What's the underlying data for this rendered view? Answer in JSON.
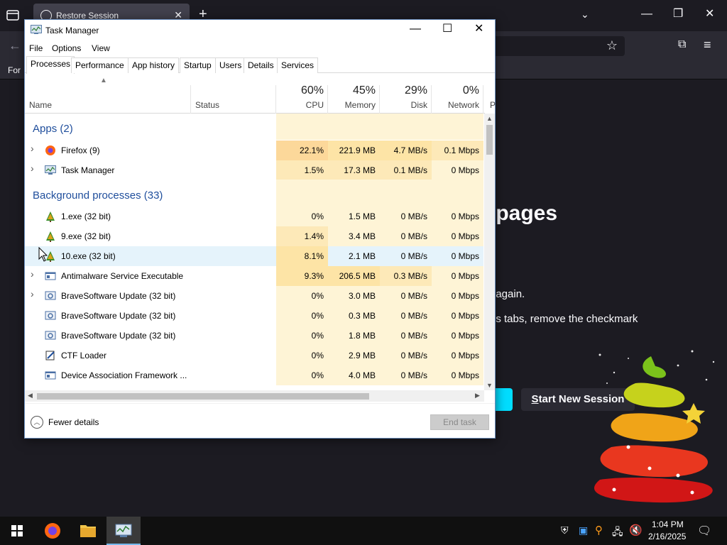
{
  "firefox": {
    "tab_title": "Restore Session",
    "bookmarks_label": "For",
    "heading": "ur pages",
    "para1": "/ again.",
    "para2": "us tabs, remove the checkmark",
    "start_new_session": "Start New Session",
    "accent": "#00ddff"
  },
  "taskmanager": {
    "title": "Task Manager",
    "menu": [
      "File",
      "Options",
      "View"
    ],
    "tabs": [
      "Processes",
      "Performance",
      "App history",
      "Startup",
      "Users",
      "Details",
      "Services"
    ],
    "active_tab": "Processes",
    "columns": {
      "name": "Name",
      "status": "Status",
      "cpu": {
        "pct": "60%",
        "label": "CPU"
      },
      "memory": {
        "pct": "45%",
        "label": "Memory"
      },
      "disk": {
        "pct": "29%",
        "label": "Disk"
      },
      "network": {
        "pct": "0%",
        "label": "Network"
      },
      "power_partial": "P"
    },
    "groups": {
      "apps": "Apps (2)",
      "background": "Background processes (33)"
    },
    "apps": [
      {
        "name": "Firefox (9)",
        "cpu": "22.1%",
        "mem": "221.9 MB",
        "disk": "4.7 MB/s",
        "net": "0.1 Mbps",
        "icon": "firefox-icon",
        "expandable": true
      },
      {
        "name": "Task Manager",
        "cpu": "1.5%",
        "mem": "17.3 MB",
        "disk": "0.1 MB/s",
        "net": "0 Mbps",
        "icon": "task-manager-icon",
        "expandable": true
      }
    ],
    "background": [
      {
        "name": "1.exe (32 bit)",
        "cpu": "0%",
        "mem": "1.5 MB",
        "disk": "0 MB/s",
        "net": "0 Mbps",
        "icon": "tree-icon",
        "expandable": false
      },
      {
        "name": "9.exe (32 bit)",
        "cpu": "1.4%",
        "mem": "3.4 MB",
        "disk": "0 MB/s",
        "net": "0 Mbps",
        "icon": "tree-icon",
        "expandable": false
      },
      {
        "name": "10.exe (32 bit)",
        "cpu": "8.1%",
        "mem": "2.1 MB",
        "disk": "0 MB/s",
        "net": "0 Mbps",
        "icon": "tree-icon",
        "expandable": false
      },
      {
        "name": "Antimalware Service Executable",
        "cpu": "9.3%",
        "mem": "206.5 MB",
        "disk": "0.3 MB/s",
        "net": "0 Mbps",
        "icon": "service-icon",
        "expandable": true
      },
      {
        "name": "BraveSoftware Update (32 bit)",
        "cpu": "0%",
        "mem": "3.0 MB",
        "disk": "0 MB/s",
        "net": "0 Mbps",
        "icon": "updater-icon",
        "expandable": true
      },
      {
        "name": "BraveSoftware Update (32 bit)",
        "cpu": "0%",
        "mem": "0.3 MB",
        "disk": "0 MB/s",
        "net": "0 Mbps",
        "icon": "updater-icon",
        "expandable": false
      },
      {
        "name": "BraveSoftware Update (32 bit)",
        "cpu": "0%",
        "mem": "1.8 MB",
        "disk": "0 MB/s",
        "net": "0 Mbps",
        "icon": "updater-icon",
        "expandable": false
      },
      {
        "name": "CTF Loader",
        "cpu": "0%",
        "mem": "2.9 MB",
        "disk": "0 MB/s",
        "net": "0 Mbps",
        "icon": "ctf-icon",
        "expandable": false
      },
      {
        "name": "Device Association Framework ...",
        "cpu": "0%",
        "mem": "4.0 MB",
        "disk": "0 MB/s",
        "net": "0 Mbps",
        "icon": "service-icon",
        "expandable": false
      }
    ],
    "fewer_details": "Fewer details",
    "end_task": "End task"
  },
  "taskbar": {
    "time": "1:04 PM",
    "date": "2/16/2025"
  }
}
